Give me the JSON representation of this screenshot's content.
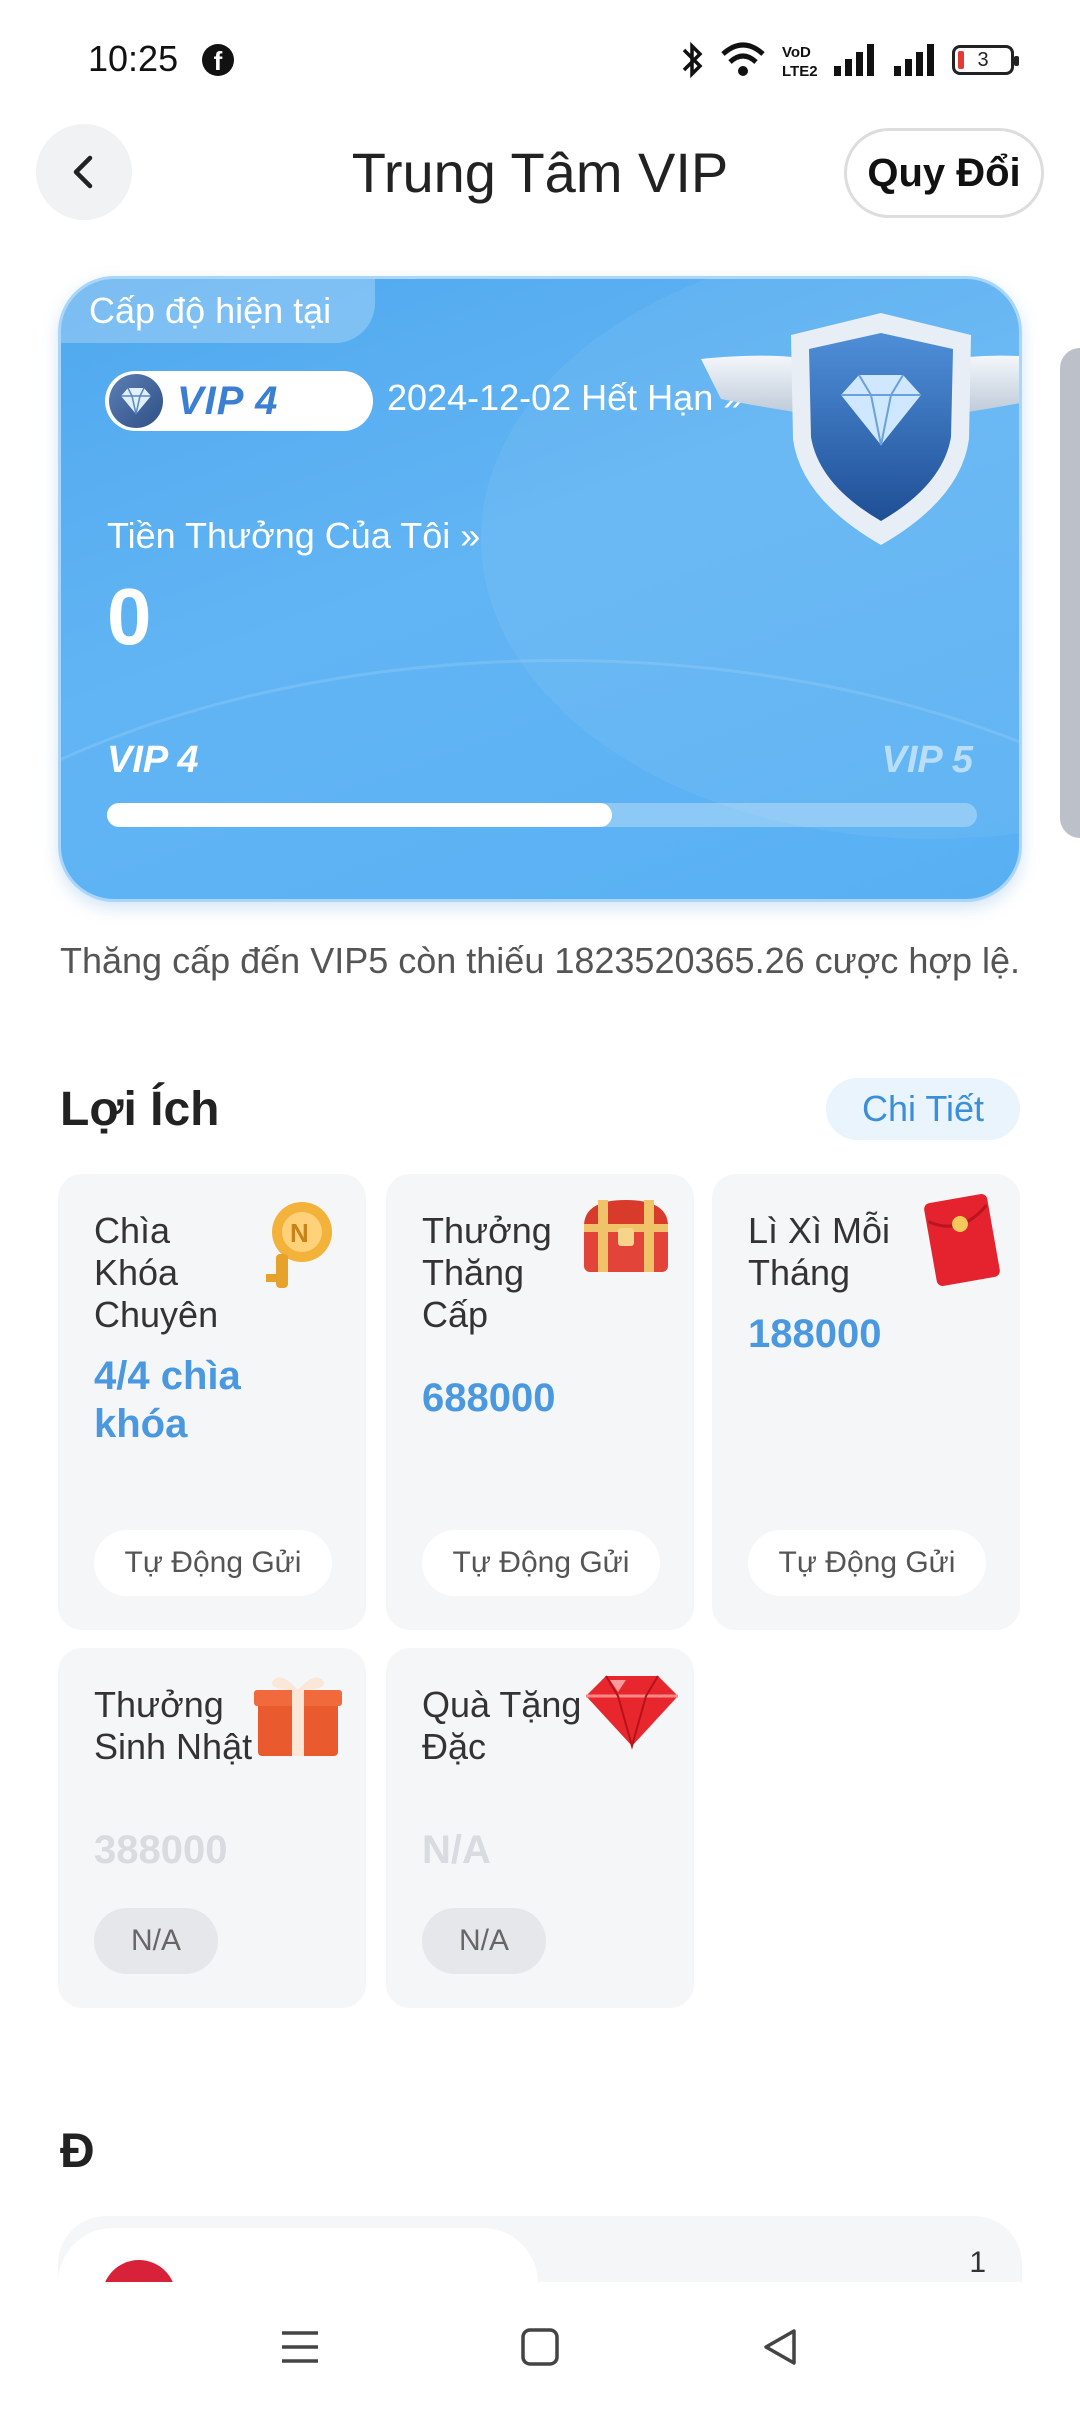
{
  "status_bar": {
    "time": "10:25",
    "battery": "3",
    "icons": [
      "facebook-icon",
      "bluetooth-icon",
      "wifi-icon",
      "volte-icon",
      "signal-icon",
      "signal-icon",
      "battery-icon"
    ]
  },
  "header": {
    "title": "Trung Tâm VIP",
    "redeem_label": "Quy Đổi"
  },
  "vip_card": {
    "level_tag": "Cấp độ hiện tại",
    "badge": "VIP 4",
    "expire": "2024-12-02 Hết Hạn »",
    "bonus_label": "Tiền Thưởng Của Tôi »",
    "bonus_value": "0",
    "current_level": "VIP 4",
    "next_level": "VIP 5",
    "progress": 0.58
  },
  "upgrade_note": "Thăng cấp đến VIP5 còn thiếu 1823520365.26 cược hợp lệ.",
  "benefits": {
    "title": "Lợi Ích",
    "detail_label": "Chi Tiết",
    "items": [
      {
        "title": "Chìa Khóa Chuyên",
        "value": "4/4 chìa khóa",
        "button": "Tự Động Gửi",
        "icon": "golden-key-icon"
      },
      {
        "title": "Thưởng Thăng Cấp",
        "value": "688000",
        "button": "Tự Động Gửi",
        "icon": "treasure-chest-icon"
      },
      {
        "title": "Lì Xì Mỗi Tháng",
        "value": "188000",
        "button": "Tự Động Gửi",
        "icon": "red-envelope-icon"
      },
      {
        "title": "Thưởng Sinh Nhật",
        "value": "388000",
        "button": "N/A",
        "icon": "gift-box-icon"
      },
      {
        "title": "Quà Tặng Đặc",
        "value": "N/A",
        "button": "N/A",
        "icon": "ruby-gem-icon"
      }
    ]
  },
  "section2": {
    "title": "Đ",
    "row_number": "1"
  },
  "colors": {
    "accent": "#4a99e0",
    "card_blue": "#5aaff2"
  }
}
